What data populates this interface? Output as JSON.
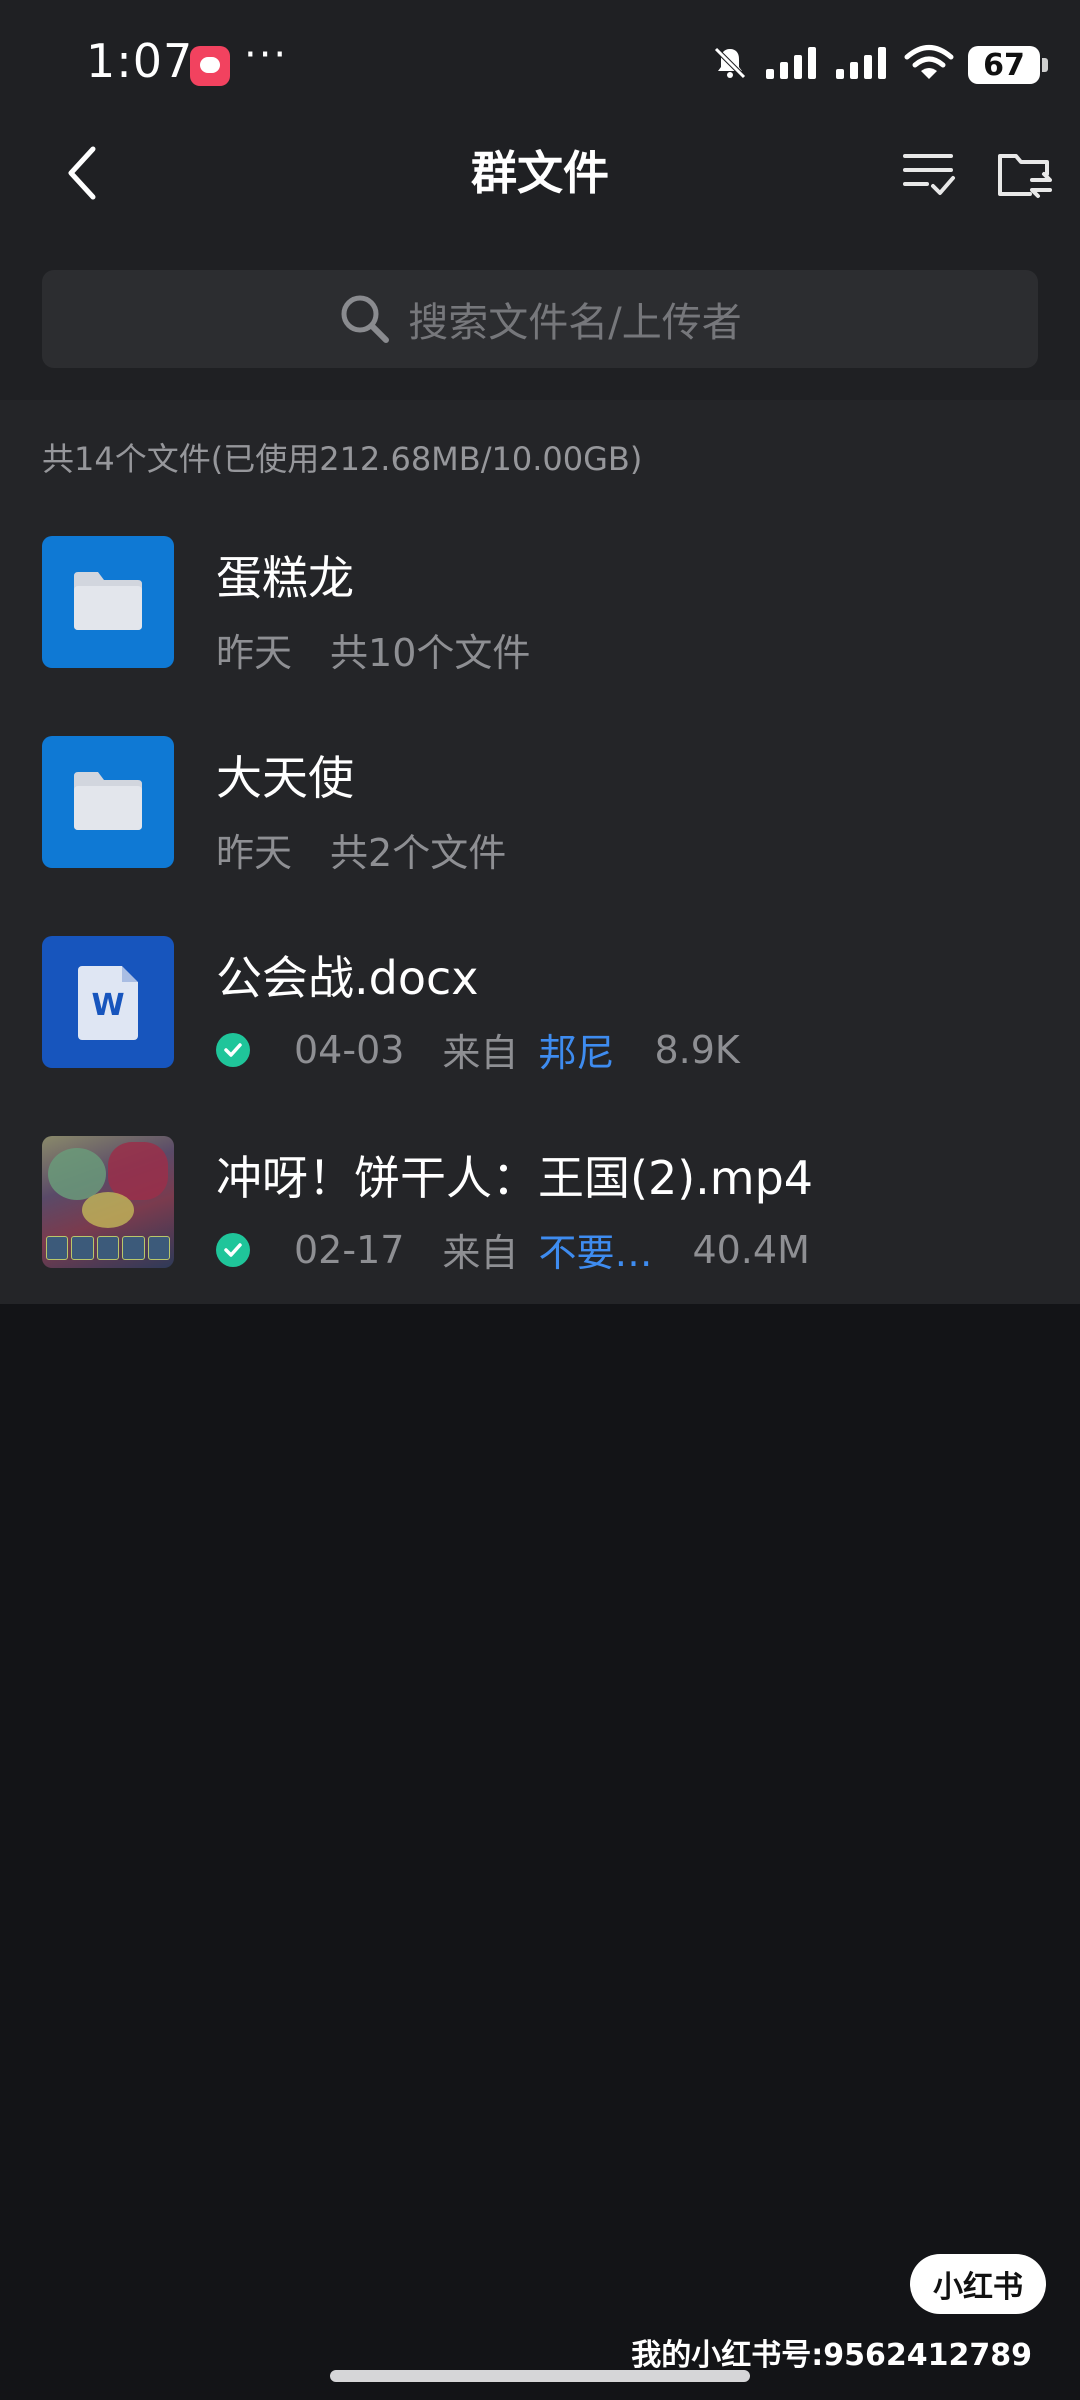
{
  "status_bar": {
    "time": "1:07",
    "dots": "···",
    "battery": "67"
  },
  "header": {
    "title": "群文件"
  },
  "search": {
    "placeholder": "搜索文件名/上传者"
  },
  "summary": "共14个文件(已使用212.68MB/10.00GB)",
  "files": [
    {
      "type": "folder",
      "icon": "folder-icon",
      "name": "蛋糕龙",
      "date": "昨天",
      "count": "共10个文件"
    },
    {
      "type": "folder",
      "icon": "folder-icon",
      "name": "大天使",
      "date": "昨天",
      "count": "共2个文件"
    },
    {
      "type": "docx",
      "icon": "word-doc-icon",
      "icon_letter": "W",
      "name": "公会战.docx",
      "date": "04-03",
      "from": "来自",
      "uploader": "邦尼",
      "size": "8.9K",
      "downloaded": true
    },
    {
      "type": "mp4",
      "icon": "video-thumbnail",
      "name": "冲呀！饼干人：王国(2).mp4",
      "date": "02-17",
      "from": "来自",
      "uploader": "不要…",
      "size": "40.4M",
      "downloaded": true
    }
  ],
  "watermark": {
    "logo": "小红书",
    "id_text": "我的小红书号:9562412789"
  },
  "colors": {
    "background": "#131417",
    "header_bg": "#1f2023",
    "list_bg": "#242528",
    "folder_blue": "#0f79d4",
    "word_blue": "#1755bd",
    "accent_link": "#3e8cf0",
    "check_green": "#1fc59a"
  }
}
